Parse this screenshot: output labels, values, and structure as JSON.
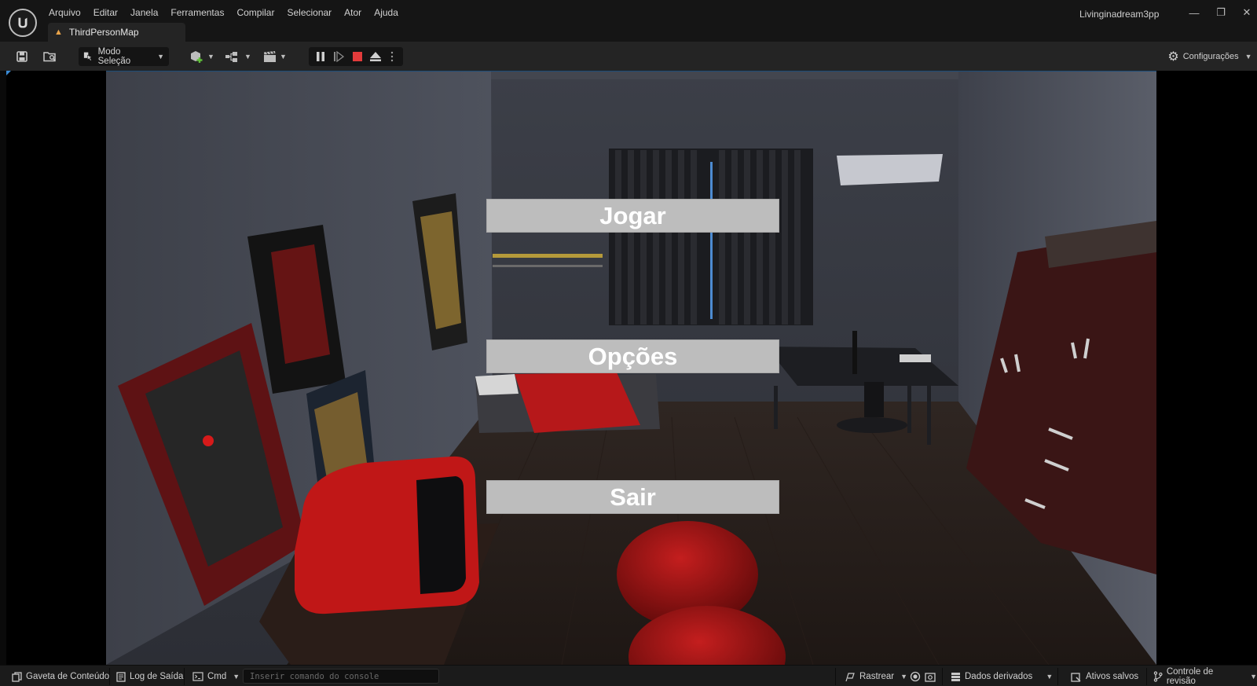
{
  "menu": {
    "items": [
      "Arquivo",
      "Editar",
      "Janela",
      "Ferramentas",
      "Compilar",
      "Selecionar",
      "Ator",
      "Ajuda"
    ]
  },
  "tab": {
    "label": "ThirdPersonMap"
  },
  "project": {
    "name": "Livinginadream3pp"
  },
  "window_controls": {
    "minimize": "—",
    "restore": "❐",
    "close": "✕"
  },
  "toolbar": {
    "mode_label": "Modo Seleção",
    "settings_label": "Configurações"
  },
  "game_menu": {
    "play_label": "Jogar",
    "options_label": "Opções",
    "quit_label": "Sair"
  },
  "statusbar": {
    "content_drawer": "Gaveta de Conteúdo",
    "output_log": "Log de Saída",
    "cmd": "Cmd",
    "console_placeholder": "Inserir comando do console",
    "trace": "Rastrear",
    "derived_data": "Dados derivados",
    "saved_assets": "Ativos salvos",
    "revision_control": "Controle de revisão"
  },
  "colors": {
    "accent_blue": "#3a8bd6",
    "stop_red": "#e23b3b",
    "button_gray": "#bdbdbd",
    "tab_icon_orange": "#e8a34a"
  }
}
